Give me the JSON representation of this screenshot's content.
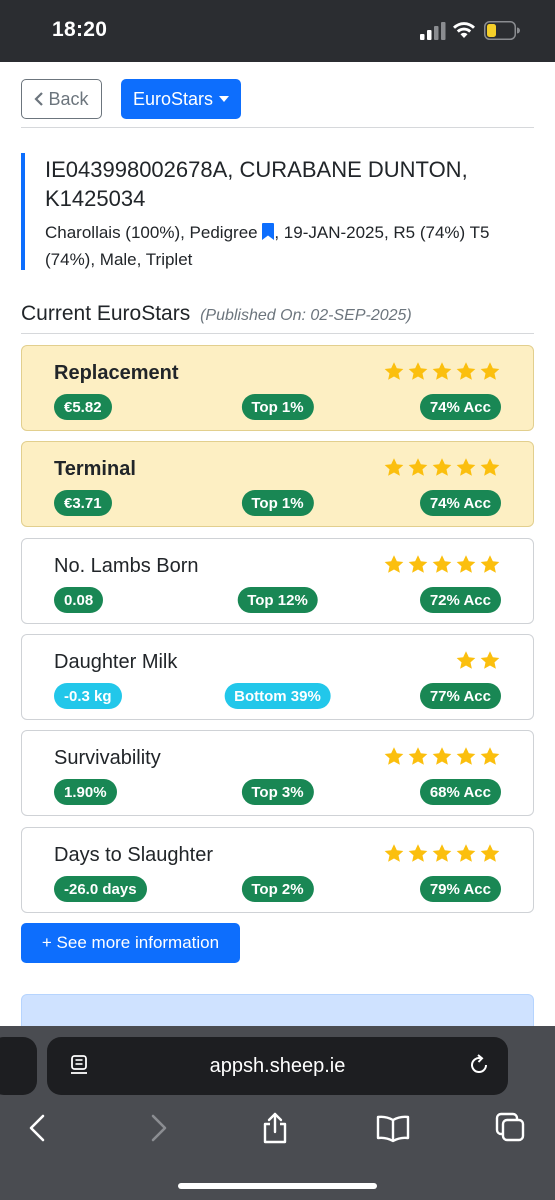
{
  "status_bar": {
    "time": "18:20"
  },
  "nav": {
    "back_label": "Back",
    "menu_label": "EuroStars"
  },
  "animal": {
    "title": "IE043998002678A, CURABANE DUNTON, K1425034",
    "meta_before_icon": "Charollais (100%), Pedigree",
    "meta_after_icon": ", 19-JAN-2025, R5 (74%) T5 (74%), Male, Triplet"
  },
  "section": {
    "title": "Current EuroStars",
    "published": "(Published On: 02-SEP-2025)"
  },
  "traits": [
    {
      "name": "Replacement",
      "stars": 5,
      "value": "€5.82",
      "rank": "Top 1%",
      "accuracy": "74% Acc"
    },
    {
      "name": "Terminal",
      "stars": 5,
      "value": "€3.71",
      "rank": "Top 1%",
      "accuracy": "74% Acc"
    },
    {
      "name": "No. Lambs Born",
      "stars": 5,
      "value": "0.08",
      "rank": "Top 12%",
      "accuracy": "72% Acc"
    },
    {
      "name": "Daughter Milk",
      "stars": 2,
      "value": "-0.3 kg",
      "rank": "Bottom 39%",
      "accuracy": "77% Acc"
    },
    {
      "name": "Survivability",
      "stars": 5,
      "value": "1.90%",
      "rank": "Top 3%",
      "accuracy": "68% Acc"
    },
    {
      "name": "Days to Slaughter",
      "stars": 5,
      "value": "-26.0 days",
      "rank": "Top 2%",
      "accuracy": "79% Acc"
    }
  ],
  "see_more_label": "+ See more information",
  "browser": {
    "url": "appsh.sheep.ie"
  },
  "colors": {
    "primary": "#0d6efd",
    "success": "#198754",
    "info": "#22c7ea",
    "highlight": "#fdefc3",
    "star": "#fbbf0e"
  }
}
